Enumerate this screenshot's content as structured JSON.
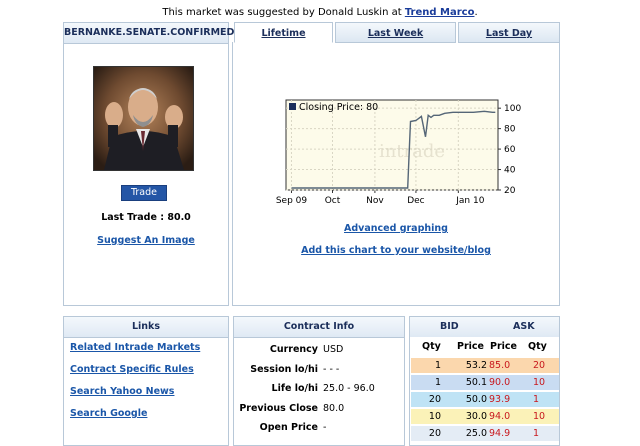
{
  "header": {
    "note_prefix": "This market was suggested by Donald Luskin at",
    "link_text": "Trend Marco",
    "note_suffix": "."
  },
  "market": {
    "title": "BERNANKE.SENATE.CONFIRMED",
    "trade_label": "Trade",
    "last_trade": "Last Trade : 80.0",
    "suggest_image": "Suggest An Image"
  },
  "tabs": [
    {
      "label": "Lifetime",
      "active": true
    },
    {
      "label": "Last Week",
      "active": false
    },
    {
      "label": "Last Day",
      "active": false
    }
  ],
  "chart_data": {
    "type": "line",
    "title": "",
    "legend": "Closing Price: 80",
    "watermark": "intrade",
    "x_ticks": [
      "Sep 09",
      "Oct",
      "Nov",
      "Dec",
      "Jan 10"
    ],
    "y_ticks": [
      20,
      40,
      60,
      80,
      100
    ],
    "ylim": [
      20,
      108
    ],
    "x": [
      "2009-09-01",
      "2009-09-15",
      "2009-10-01",
      "2009-10-15",
      "2009-11-01",
      "2009-11-15",
      "2009-11-25",
      "2009-11-26",
      "2009-11-27",
      "2009-12-01",
      "2009-12-03",
      "2009-12-05",
      "2009-12-08",
      "2009-12-10",
      "2009-12-12",
      "2009-12-14",
      "2009-12-18",
      "2009-12-22",
      "2009-12-28",
      "2010-01-05",
      "2010-01-12",
      "2010-01-20",
      "2010-01-26",
      "2010-01-28"
    ],
    "y": [
      22,
      22,
      22,
      22,
      22,
      22,
      22,
      55,
      87,
      88,
      90,
      92,
      72,
      93,
      91,
      93,
      93,
      95,
      96,
      96,
      96,
      97,
      96,
      96
    ],
    "grid": true,
    "axis_side": "right",
    "colors": {
      "line": "#556677",
      "plot_bg": "#fdfbea",
      "legend_box": "#1b2e5a"
    }
  },
  "links": {
    "advanced": "Advanced graphing",
    "embed": "Add this chart to your website/blog"
  },
  "links_panel": {
    "title": "Links",
    "items": [
      "Related Intrade Markets",
      "Contract Specific Rules",
      "Search Yahoo News",
      "Search Google"
    ]
  },
  "contract_info": {
    "title": "Contract Info",
    "rows": [
      {
        "label": "Currency",
        "value": "USD"
      },
      {
        "label": "Session lo/hi",
        "value": "- - -"
      },
      {
        "label": "Life lo/hi",
        "value": "25.0 - 96.0"
      },
      {
        "label": "Previous Close",
        "value": "80.0"
      },
      {
        "label": "Open Price",
        "value": "-"
      }
    ]
  },
  "orderbook": {
    "bid_label": "BID",
    "ask_label": "ASK",
    "columns": [
      "Qty",
      "Price",
      "Price",
      "Qty"
    ],
    "rows": [
      {
        "bid_qty": "1",
        "bid_price": "53.2",
        "ask_price": "85.0",
        "ask_qty": "20",
        "color": "#fbd7ad"
      },
      {
        "bid_qty": "1",
        "bid_price": "50.1",
        "ask_price": "90.0",
        "ask_qty": "10",
        "color": "#c9dcf2"
      },
      {
        "bid_qty": "20",
        "bid_price": "50.0",
        "ask_price": "93.9",
        "ask_qty": "1",
        "color": "#bfe3f5"
      },
      {
        "bid_qty": "10",
        "bid_price": "30.0",
        "ask_price": "94.0",
        "ask_qty": "10",
        "color": "#fbf2b8"
      },
      {
        "bid_qty": "20",
        "bid_price": "25.0",
        "ask_price": "94.9",
        "ask_qty": "1",
        "color": "#e4ecf5"
      }
    ]
  }
}
